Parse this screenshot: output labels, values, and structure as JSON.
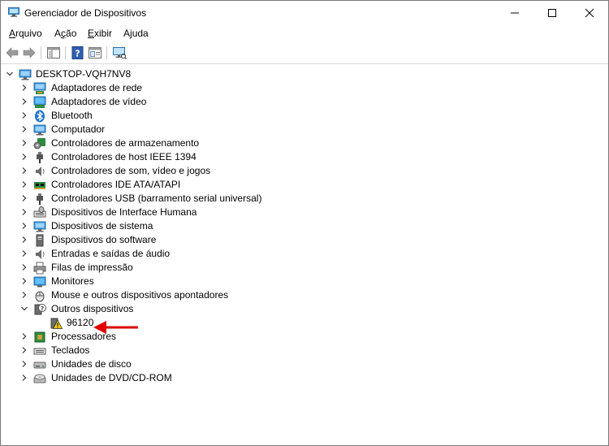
{
  "window": {
    "title": "Gerenciador de Dispositivos"
  },
  "menu": [
    {
      "label": "Arquivo",
      "accel": "A",
      "rest": "rquivo"
    },
    {
      "label": "Ação",
      "accel": "ç",
      "pre": "A",
      "rest": "ão"
    },
    {
      "label": "Exibir",
      "accel": "E",
      "rest": "xibir"
    },
    {
      "label": "Ajuda",
      "accel": "j",
      "pre": "A",
      "rest": "uda"
    }
  ],
  "tree": {
    "root": "DESKTOP-VQH7NV8",
    "categories": [
      {
        "label": "Adaptadores de rede",
        "icon": "network-adapter-icon"
      },
      {
        "label": "Adaptadores de vídeo",
        "icon": "display-adapter-icon"
      },
      {
        "label": "Bluetooth",
        "icon": "bluetooth-icon"
      },
      {
        "label": "Computador",
        "icon": "computer-icon"
      },
      {
        "label": "Controladores de armazenamento",
        "icon": "storage-controller-icon"
      },
      {
        "label": "Controladores de host IEEE 1394",
        "icon": "ieee1394-icon"
      },
      {
        "label": "Controladores de som, vídeo e jogos",
        "icon": "speaker-icon"
      },
      {
        "label": "Controladores IDE ATA/ATAPI",
        "icon": "ide-controller-icon"
      },
      {
        "label": "Controladores USB (barramento serial universal)",
        "icon": "usb-icon"
      },
      {
        "label": "Dispositivos de Interface Humana",
        "icon": "hid-icon"
      },
      {
        "label": "Dispositivos de sistema",
        "icon": "system-device-icon"
      },
      {
        "label": "Dispositivos do software",
        "icon": "software-device-icon"
      },
      {
        "label": "Entradas e saídas de áudio",
        "icon": "audio-io-icon"
      },
      {
        "label": "Filas de impressão",
        "icon": "printer-icon"
      },
      {
        "label": "Monitores",
        "icon": "monitor-icon"
      },
      {
        "label": "Mouse e outros dispositivos apontadores",
        "icon": "mouse-icon"
      },
      {
        "label": "Outros dispositivos",
        "icon": "unknown-device-icon",
        "expanded": true
      },
      {
        "label": "96120",
        "icon": "warning-device-icon",
        "child": true
      },
      {
        "label": "Processadores",
        "icon": "processor-icon"
      },
      {
        "label": "Teclados",
        "icon": "keyboard-icon"
      },
      {
        "label": "Unidades de disco",
        "icon": "disk-drive-icon"
      },
      {
        "label": "Unidades de DVD/CD-ROM",
        "icon": "dvd-drive-icon"
      }
    ]
  },
  "colors": {
    "annotation_arrow": "#e00000",
    "accent": "#0078d7"
  }
}
